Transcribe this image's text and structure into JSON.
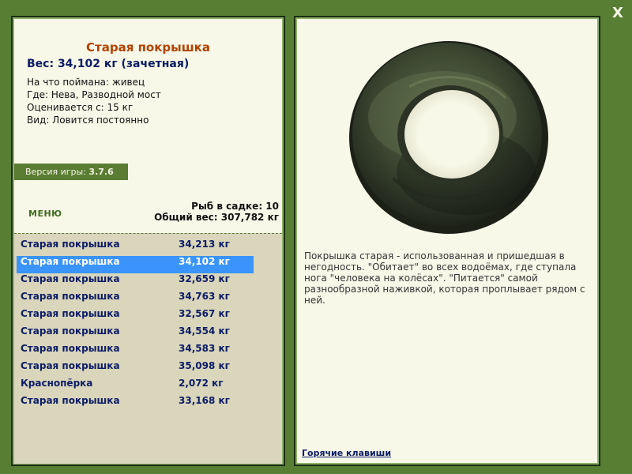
{
  "close_label": "X",
  "fish_card": {
    "title": "Старая покрышка",
    "weight_line": "Вес: 34,102 кг (зачетная)",
    "bait_line": "На что поймана: живец",
    "location_line": "Где: Нева, Разводной мост",
    "threshold_line": "Оценивается с: 15 кг",
    "kind_line": "Вид: Ловится постоянно"
  },
  "version": {
    "label": "Версия игры:",
    "value": "3.7.6"
  },
  "menu_label": "МЕНЮ",
  "keepnet": {
    "count_line": "Рыб в садке: 10",
    "total_line": "Общий вес: 307,782 кг"
  },
  "catch_list": [
    {
      "name": "Старая покрышка",
      "weight": "34,213 кг"
    },
    {
      "name": "Старая покрышка",
      "weight": "34,102 кг"
    },
    {
      "name": "Старая покрышка",
      "weight": "32,659 кг"
    },
    {
      "name": "Старая покрышка",
      "weight": "34,763 кг"
    },
    {
      "name": "Старая покрышка",
      "weight": "32,567 кг"
    },
    {
      "name": "Старая покрышка",
      "weight": "34,554 кг"
    },
    {
      "name": "Старая покрышка",
      "weight": "34,583 кг"
    },
    {
      "name": "Старая покрышка",
      "weight": "35,098 кг"
    },
    {
      "name": "Краснопёрка",
      "weight": "2,072 кг"
    },
    {
      "name": "Старая покрышка",
      "weight": "33,168 кг"
    }
  ],
  "selected_row": 1,
  "description": "Покрышка старая - использованная и пришедшая в негодность. \"Обитает\" во всех водоёмах, где ступала нога \"человека на колёсах\". \"Питается\" самой разнообразной наживкой, которая проплывает рядом с ней.",
  "hotkeys_label": "Горячие клавиши",
  "colors": {
    "background": "#587e34",
    "panel": "#f8f8e8",
    "selection": "#3a94fc",
    "title": "#b34200",
    "text_dark_blue": "#0c1b66"
  }
}
